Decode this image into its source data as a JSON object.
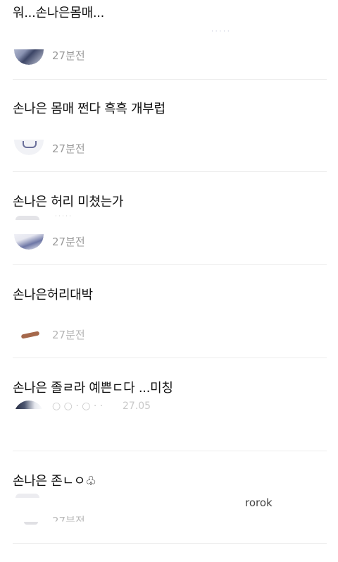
{
  "comments": [
    {
      "text": "워...손나은몸매...",
      "time": "27분전"
    },
    {
      "text": "손나은 몸매 쩐다 흑흑 개부럽",
      "time": "27분전"
    },
    {
      "text": "손나은 허리 미쳤는가",
      "time": "27분전"
    },
    {
      "text": "손나은허리대박",
      "time": "27분전"
    },
    {
      "text": "손나은 졸ㄹ라 예쁜ㄷ다 ...미칭",
      "time": ""
    },
    {
      "text": "손나은 존ㄴㅇ♧",
      "time": "27분전"
    }
  ],
  "partial_texts": {
    "c5_meta": "27.05",
    "c6_meta": "rorok"
  }
}
